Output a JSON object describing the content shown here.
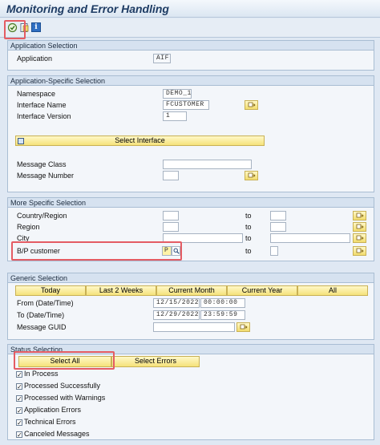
{
  "header": {
    "title": "Monitoring and Error Handling"
  },
  "toolbar": {
    "icons": [
      "execute-icon",
      "variant-icon",
      "info-icon"
    ],
    "info_glyph": "i"
  },
  "application_selection": {
    "title": "Application Selection",
    "application_label": "Application",
    "application_value": "AIF"
  },
  "app_specific": {
    "title": "Application-Specific Selection",
    "namespace_label": "Namespace",
    "namespace_value": "DEMO_1",
    "interface_name_label": "Interface Name",
    "interface_name_value": "FCUSTOMER",
    "interface_version_label": "Interface Version",
    "interface_version_value": "1",
    "select_interface_label": "Select Interface",
    "message_class_label": "Message Class",
    "message_number_label": "Message Number"
  },
  "more_specific": {
    "title": "More Specific Selection",
    "country_label": "Country/Region",
    "region_label": "Region",
    "city_label": "City",
    "bp_label": "B/P customer",
    "bp_value": "P",
    "to_label": "to"
  },
  "generic": {
    "title": "Generic Selection",
    "buttons": [
      "Today",
      "Last 2 Weeks",
      "Current Month",
      "Current Year",
      "All"
    ],
    "from_label": "From (Date/Time)",
    "from_date": "12/15/2022",
    "from_time": "00:00:00",
    "to_label": "To (Date/Time)",
    "to_date": "12/29/2022",
    "to_time": "23:59:59",
    "guid_label": "Message GUID"
  },
  "status": {
    "title": "Status Selection",
    "select_all_label": "Select All",
    "select_errors_label": "Select Errors",
    "check_mark": "✓",
    "items": [
      {
        "label": "In Process",
        "checked": true
      },
      {
        "label": "Processed Successfully",
        "checked": true
      },
      {
        "label": "Processed with Warnings",
        "checked": true
      },
      {
        "label": "Application Errors",
        "checked": true
      },
      {
        "label": "Technical Errors",
        "checked": true
      },
      {
        "label": "Canceled Messages",
        "checked": true
      }
    ]
  },
  "colors": {
    "highlight": "#e45c63",
    "button_yellow": "#f5e27a",
    "group_header": "#d6e2f0"
  }
}
